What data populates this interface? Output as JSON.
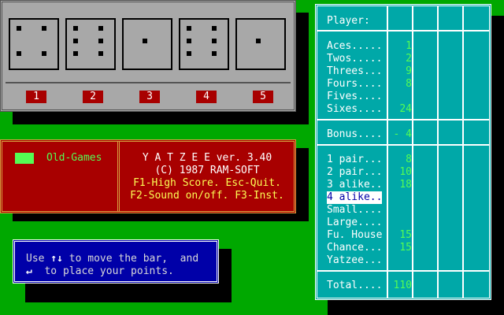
{
  "dice": [
    {
      "label": "1",
      "face": 4
    },
    {
      "label": "2",
      "face": 6
    },
    {
      "label": "3",
      "face": 1
    },
    {
      "label": "4",
      "face": 6
    },
    {
      "label": "5",
      "face": 1
    }
  ],
  "banner": {
    "old_games": "Old-Games",
    "title": "Y A T Z E E  ver. 3.40",
    "copyright": "(C) 1987  RAM-SOFT",
    "keys1": "F1-High Score.  Esc-Quit.",
    "keys2": "F2-Sound on/off. F3-Inst."
  },
  "help": {
    "line1_a": "Use ",
    "line1_arrows": "↑↓",
    "line1_b": " to move the bar,  and",
    "line2_arrow": "↵",
    "line2_b": "  to place your points."
  },
  "scorecard": {
    "player_label": "Player:",
    "upper": [
      {
        "label": "Aces.....",
        "score": "1"
      },
      {
        "label": "Twos.....",
        "score": "2"
      },
      {
        "label": "Threes...",
        "score": "9"
      },
      {
        "label": "Fours....",
        "score": "8"
      },
      {
        "label": "Fives....",
        "score": ""
      },
      {
        "label": "Sixes....",
        "score": "24"
      }
    ],
    "bonus": {
      "label": "Bonus....",
      "score": "- 4"
    },
    "lower": [
      {
        "label": "1 pair...",
        "score": "8"
      },
      {
        "label": "2 pair...",
        "score": "10"
      },
      {
        "label": "3 alike..",
        "score": "18"
      },
      {
        "label": "4 alike..",
        "score": ""
      },
      {
        "label": "Small....",
        "score": ""
      },
      {
        "label": "Large....",
        "score": ""
      },
      {
        "label": "Fu. House",
        "score": "15"
      },
      {
        "label": "Chance...",
        "score": "15"
      },
      {
        "label": "Yatzee...",
        "score": ""
      }
    ],
    "total": {
      "label": "Total....",
      "score": "110"
    }
  }
}
